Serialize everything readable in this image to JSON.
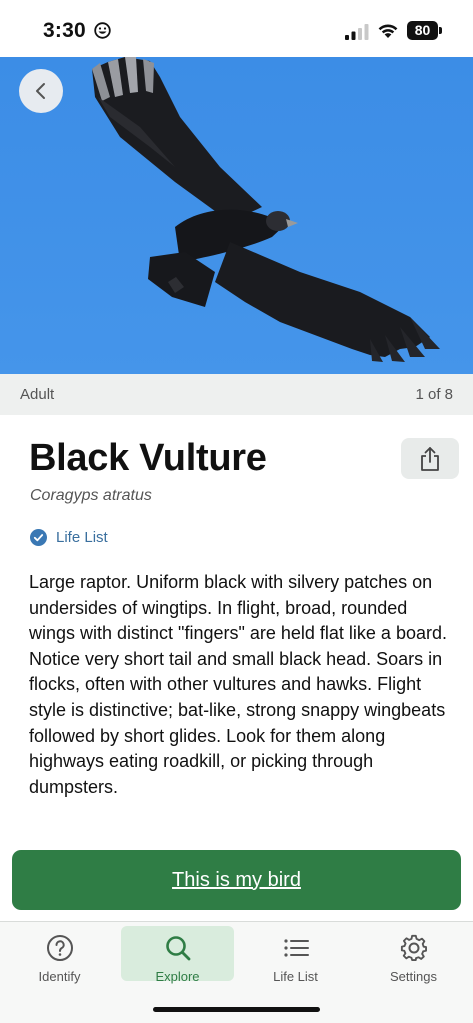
{
  "status_bar": {
    "time": "3:30",
    "battery": "80"
  },
  "photo": {
    "age_label": "Adult",
    "counter": "1 of 8"
  },
  "species": {
    "common_name": "Black Vulture",
    "scientific_name": "Coragyps atratus",
    "life_list_label": "Life List",
    "description": "Large raptor. Uniform black with silvery patches on undersides of wingtips. In flight, broad, rounded wings with distinct \"fingers\" are held flat like a board. Notice very short tail and small black head. Soars in flocks, often with other vultures and hawks. Flight style is distinctive; bat-like, strong snappy wingbeats followed by short glides. Look for them along highways eating roadkill, or picking through dumpsters."
  },
  "cta": {
    "label": "This is my bird"
  },
  "tabs": [
    {
      "label": "Identify",
      "icon": "question-circle-icon",
      "active": false
    },
    {
      "label": "Explore",
      "icon": "search-icon",
      "active": true
    },
    {
      "label": "Life List",
      "icon": "list-icon",
      "active": false
    },
    {
      "label": "Settings",
      "icon": "gear-icon",
      "active": false
    }
  ],
  "colors": {
    "brand_green": "#2f7d45",
    "sky_blue": "#3f8fe6",
    "badge_blue": "#3a6f9e"
  }
}
